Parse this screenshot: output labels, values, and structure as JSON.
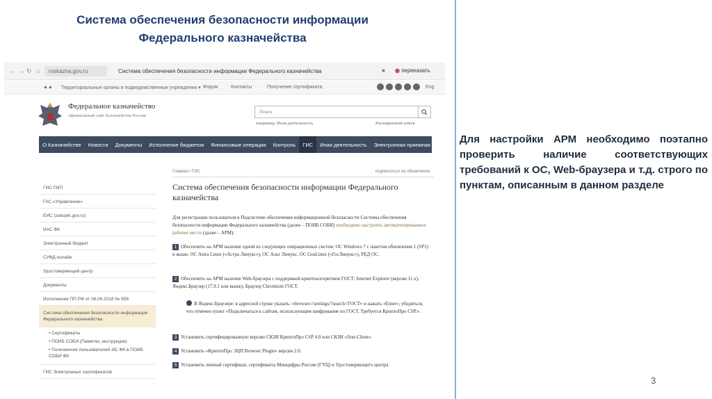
{
  "slide": {
    "title_line1": "Система обеспечения безопасности  информации",
    "title_line2": "Федерального казначейства",
    "right_text": "Для настройки АРМ необходимо поэтапно проверить наличие соответствующих требований к ОС, Web-браузера и т.д. строго по пунктам, описанным в данном разделе",
    "page_number": "3"
  },
  "browser": {
    "url": "roskazna.gov.ru",
    "tab_title": "Система обеспечения безопасности информации Федерального казначейства",
    "translate": "переказать"
  },
  "site": {
    "top_links": [
      "Территориальные органы и подведомственные учреждения ▾",
      "Форум",
      "Контакты",
      "Получение сертификата"
    ],
    "lang": "Eng",
    "org_name": "Федеральное казначейство",
    "org_subtitle": "официальный сайт Казначейства России",
    "search_placeholder": "Поиск",
    "search_hint": "например, Иная деятельность",
    "advanced_search": "Расширенный поиск",
    "nav": [
      "О Казначействе",
      "Новости",
      "Документы",
      "Исполнение бюджетов",
      "Финансовые операции",
      "Контроль",
      "ГИС",
      "Иная деятельность",
      "Электронная приемная"
    ],
    "sidebar": {
      "items_top": [
        "ГИС ГМП",
        "ГАС «Управление»",
        "ЕИС (zakupki.gov.ru)",
        "ИАС ФК",
        "Электронный бюджет",
        "СУФД-онлайн",
        "Удостоверяющий центр",
        "Документы",
        "Исполнение ПП РФ от 08.06.2018 № 658"
      ],
      "active": "Система обеспечения безопасности информации Федерального казначейства",
      "sub": [
        "• Сертификаты",
        "• ПОИБ СОБИ (Памятки, инструкции)",
        "• Полномочия пользователей ИС ФК в ПОИБ СОБИ ФК"
      ],
      "items_bottom": [
        "ГИС Электронных сертификатов"
      ]
    },
    "content": {
      "breadcrumbs": "Главная  /  ГИС",
      "subscribe": "подписаться на обновления",
      "title": "Система обеспечения безопасности информации Федерального казначейства",
      "intro_a": "Для регистрации пользователя в Подсистеме обеспечения информационной безопасности Системы обеспечения безопасности информации Федерального казначейства (далее – ПОИБ СОБИ) ",
      "intro_link": "необходимо настроить автоматизированное рабочее место",
      "intro_b": " (далее – АРМ):",
      "steps": [
        {
          "n": "1",
          "text": "Обеспечить на АРМ наличие одной из следующих операционных систем: ОС Windows 7 с пакетом обновления 1 (SP1) и выше, ОС Astra Linux («Астра Линукс»), ОС Альт Линукс, ОС GosLinux («ГосЛинукс»), РЕД ОС."
        },
        {
          "n": "2",
          "text": "Обеспечить на АРМ наличие Web-браузера с поддержкой криптоалгоритмов ГОСТ:  Internet Explorer (версии 11.x), Яндекс.Браузер (17.9.1 или выше), Браузер Chromium ГОСТ."
        },
        {
          "n": "3",
          "text": "Установить сертифицированную версию СКЗИ КриптоПро CSP 4.0 или СКЗИ «Jinn-Client»."
        },
        {
          "n": "4",
          "text": "Установить «КриптоПро ЭЦП Browser Plugin» версии 2.0."
        },
        {
          "n": "5",
          "text": "Установить личный сертификат, сертификаты Минцифры России (ГУЦ) и Удостоверяющего центра"
        }
      ],
      "note": "В Яндекс.Браузере: в адресной строке указать: «browser://settings/?search=ГОСТ» и нажать «Enter»; убедиться, что отмечен пункт «Подключаться к сайтам, использующим шифрование по ГОСТ. Требуется КриптоПро CSP.»."
    }
  }
}
